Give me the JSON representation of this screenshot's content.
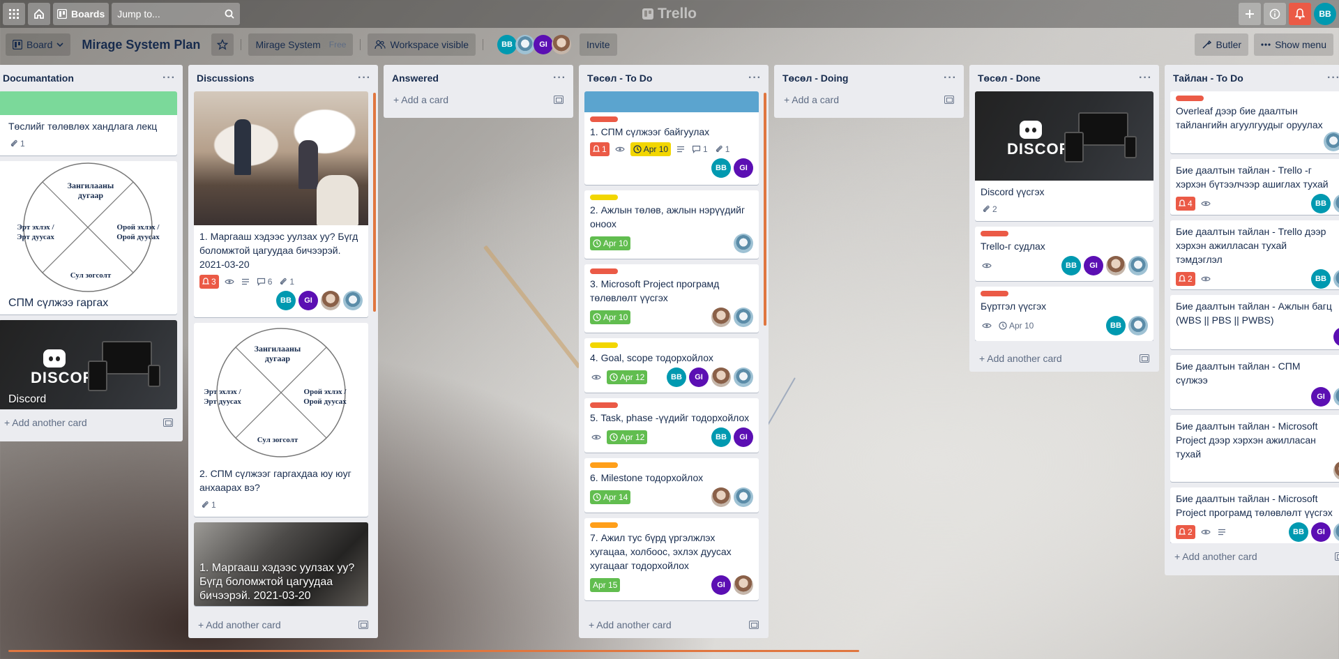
{
  "topbar": {
    "boards_label": "Boards",
    "search_placeholder": "Jump to...",
    "logo_text": "Trello",
    "user_initials": "BB"
  },
  "board": {
    "menu_label": "Board",
    "title": "Mirage System Plan",
    "workspace_name": "Mirage System",
    "workspace_plan": "Free",
    "visibility_label": "Workspace visible",
    "invite_label": "Invite",
    "butler_label": "Butler",
    "show_menu_label": "Show menu",
    "members": [
      {
        "initials": "BB",
        "type": "bb"
      },
      {
        "initials": "",
        "type": "ph2"
      },
      {
        "initials": "GI",
        "type": "gi"
      },
      {
        "initials": "",
        "type": "ph1"
      }
    ]
  },
  "common": {
    "add_another_card": "Add another card",
    "add_a_card": "Add a card"
  },
  "lists": {
    "documentation": {
      "title": "Documantation",
      "card1": {
        "title": "Төслийг төлөвлөх хандлага лекц",
        "attachments": "1"
      },
      "card2": {
        "title": "СПМ сүлжээ гаргах"
      },
      "card3": {
        "title": "Discord"
      }
    },
    "discussions": {
      "title": "Discussions",
      "card1": {
        "title": "1. Маргааш хэдээс уулзах уу? Бүгд боломжтой цагуудаа бичээрэй. 2021-03-20",
        "notifications": "3",
        "comments": "6",
        "attachments": "1"
      },
      "card2": {
        "title": "2. СПМ сүлжээг гаргахдаа юу юуг анхаарах вэ?",
        "attachments": "1"
      },
      "card3": {
        "title": "1. Маргааш хэдээс уулзах уу? Бүгд боломжтой цагуудаа бичээрэй. 2021-03-20"
      }
    },
    "answered": {
      "title": "Answered"
    },
    "todo": {
      "title": "Төсөл - To Do",
      "cards": [
        {
          "title": "1. СПМ сүлжээг байгуулах",
          "notifications": "1",
          "date": "Apr 10",
          "comments": "1",
          "attachments": "1"
        },
        {
          "title": "2. Ажлын төлөв, ажлын нэрүүдийг оноох",
          "date": "Apr 10"
        },
        {
          "title": "3. Microsoft Project програмд төлөвлөлт үүсгэх",
          "date": "Apr 10"
        },
        {
          "title": "4. Goal, scope тодорхойлох",
          "date": "Apr 12"
        },
        {
          "title": "5. Task, phase -үүдийг тодорхойлох",
          "date": "Apr 12"
        },
        {
          "title": "6. Milestone тодорхойлох",
          "date": "Apr 14"
        },
        {
          "title": "7. Ажил тус бүрд үргэлжлэх хугацаа, холбоос, эхлэх дуусах хугацааг тодорхойлох",
          "date": "Apr 15"
        }
      ]
    },
    "doing": {
      "title": "Төсөл - Doing"
    },
    "done": {
      "title": "Төсөл - Done",
      "card1": {
        "title": "Discord үүсгэх",
        "attachments": "2"
      },
      "card2": {
        "title": "Trello-г судлах"
      },
      "card3": {
        "title": "Бүртгэл үүсгэх",
        "date": "Apr 10"
      }
    },
    "report_todo": {
      "title": "Тайлан - To Do",
      "cards": [
        {
          "title": "Overleaf дээр бие даалтын тайлангийн агуулгуудыг оруулах"
        },
        {
          "title": "Бие даалтын тайлан - Trello -г хэрхэн бүтээлчээр ашиглах тухай",
          "notifications": "4"
        },
        {
          "title": "Бие даалтын тайлан - Trello дээр хэрхэн ажилласан тухай тэмдэглэл",
          "notifications": "2"
        },
        {
          "title": "Бие даалтын тайлан - Ажлын багц (WBS || PBS || PWBS)"
        },
        {
          "title": "Бие даалтын тайлан - СПМ сүлжээ"
        },
        {
          "title": "Бие даалтын тайлан - Microsoft Project дээр хэрхэн ажилласан тухай"
        },
        {
          "title": "Бие даалтын тайлан - Microsoft Project програмд төлөвлөлт үүсгэх",
          "notifications": "2"
        }
      ]
    }
  },
  "diagram": {
    "top": "Зангилааны дугаар",
    "left": "Эрт эхлэх /Эрт дуусах",
    "right": "Орой эхлэх /Орой дуусах",
    "bottom": "Сул зогсолт"
  },
  "discord_logo_text": "DISCORD",
  "colors": {
    "label_red": "#eb5a46",
    "label_yellow": "#f2d600",
    "label_orange": "#ff9f1a",
    "due_green": "#61bd4f",
    "due_yellow": "#f2d600",
    "member_bb": "#0099b0",
    "member_gi": "#5b0fb3"
  }
}
